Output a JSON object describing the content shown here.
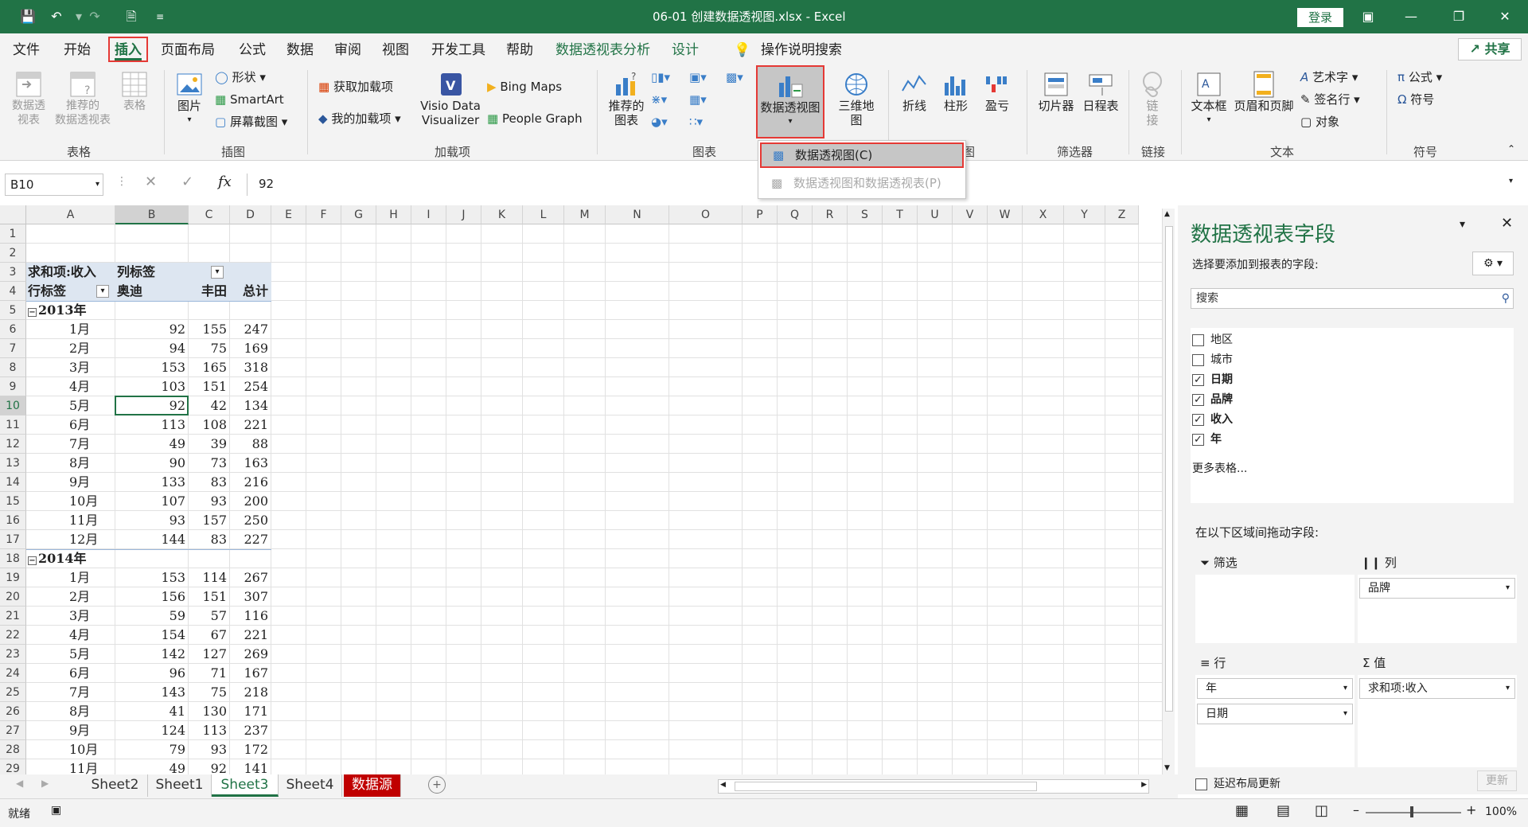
{
  "window": {
    "title": "06-01 创建数据透视图.xlsx  -  Excel",
    "login_label": "登录"
  },
  "tabs": [
    "文件",
    "开始",
    "插入",
    "页面布局",
    "公式",
    "数据",
    "审阅",
    "视图",
    "开发工具",
    "帮助",
    "数据透视表分析",
    "设计"
  ],
  "tell_me": "操作说明搜索",
  "share_label": "共享",
  "ribbon": {
    "tables": {
      "label": "表格",
      "pivot": "数据透\n视表",
      "recommended": "推荐的\n数据透视表",
      "table": "表格"
    },
    "illustrations": {
      "label": "插图",
      "pictures": "图片",
      "shapes": "形状",
      "smartart": "SmartArt",
      "screenshot": "屏幕截图"
    },
    "addins": {
      "label": "加载项",
      "get": "获取加载项",
      "my": "我的加载项",
      "visio": "Visio Data\nVisualizer",
      "bing": "Bing Maps",
      "people": "People Graph"
    },
    "charts": {
      "label": "图表",
      "recommended": "推荐的\n图表",
      "pivotchart": "数据透视图",
      "map3d": "三维地\n图"
    },
    "sparklines": {
      "line": "折线",
      "column": "柱形",
      "winloss": "盈亏"
    },
    "filters": {
      "label": "筛选器",
      "slicer": "切片器",
      "timeline": "日程表"
    },
    "links": {
      "label": "链接",
      "link": "链\n接"
    },
    "text": {
      "label": "文本",
      "textbox": "文本框",
      "headerfooter": "页眉和页脚",
      "wordart": "艺术字",
      "signature": "签名行",
      "object": "对象"
    },
    "symbols": {
      "label": "符号",
      "equation": "公式",
      "symbol": "符号"
    },
    "partial_group": "图"
  },
  "dropdown": {
    "item1": "数据透视图(C)",
    "item2": "数据透视图和数据透视表(P)"
  },
  "formula_bar": {
    "namebox": "B10",
    "fx": "fx",
    "value": "92"
  },
  "columns": [
    "A",
    "B",
    "C",
    "D",
    "E",
    "F",
    "G",
    "H",
    "I",
    "J",
    "K",
    "L",
    "M",
    "N",
    "O",
    "P",
    "Q",
    "R",
    "S",
    "T",
    "U",
    "V",
    "W",
    "X",
    "Y",
    "Z"
  ],
  "pivot": {
    "sum_label": "求和项:收入",
    "col_label": "列标签",
    "row_label": "行标签",
    "headers": [
      "奥迪",
      "丰田",
      "总计"
    ],
    "year1": "2013年",
    "year2": "2014年",
    "rows1": [
      [
        "1月",
        "92",
        "155",
        "247"
      ],
      [
        "2月",
        "94",
        "75",
        "169"
      ],
      [
        "3月",
        "153",
        "165",
        "318"
      ],
      [
        "4月",
        "103",
        "151",
        "254"
      ],
      [
        "5月",
        "92",
        "42",
        "134"
      ],
      [
        "6月",
        "113",
        "108",
        "221"
      ],
      [
        "7月",
        "49",
        "39",
        "88"
      ],
      [
        "8月",
        "90",
        "73",
        "163"
      ],
      [
        "9月",
        "133",
        "83",
        "216"
      ],
      [
        "10月",
        "107",
        "93",
        "200"
      ],
      [
        "11月",
        "93",
        "157",
        "250"
      ],
      [
        "12月",
        "144",
        "83",
        "227"
      ]
    ],
    "rows2": [
      [
        "1月",
        "153",
        "114",
        "267"
      ],
      [
        "2月",
        "156",
        "151",
        "307"
      ],
      [
        "3月",
        "59",
        "57",
        "116"
      ],
      [
        "4月",
        "154",
        "67",
        "221"
      ],
      [
        "5月",
        "142",
        "127",
        "269"
      ],
      [
        "6月",
        "96",
        "71",
        "167"
      ],
      [
        "7月",
        "143",
        "75",
        "218"
      ],
      [
        "8月",
        "41",
        "130",
        "171"
      ],
      [
        "9月",
        "124",
        "113",
        "237"
      ],
      [
        "10月",
        "79",
        "93",
        "172"
      ],
      [
        "11月",
        "49",
        "92",
        "141"
      ]
    ]
  },
  "sheets": [
    "Sheet2",
    "Sheet1",
    "Sheet3",
    "Sheet4",
    "数据源"
  ],
  "field_pane": {
    "title": "数据透视表字段",
    "subtitle": "选择要添加到报表的字段:",
    "search_placeholder": "搜索",
    "fields": [
      {
        "name": "地区",
        "checked": false
      },
      {
        "name": "城市",
        "checked": false
      },
      {
        "name": "日期",
        "checked": true
      },
      {
        "name": "品牌",
        "checked": true
      },
      {
        "name": "收入",
        "checked": true
      },
      {
        "name": "年",
        "checked": true
      }
    ],
    "more_tables": "更多表格...",
    "drag_hint": "在以下区域间拖动字段:",
    "filters_label": "筛选",
    "columns_label": "列",
    "rows_label": "行",
    "values_label": "值",
    "col_field": "品牌",
    "row_fields": [
      "年",
      "日期"
    ],
    "value_field": "求和项:收入",
    "defer_label": "延迟布局更新",
    "update_label": "更新"
  },
  "status": {
    "ready": "就绪",
    "zoom": "100%"
  }
}
